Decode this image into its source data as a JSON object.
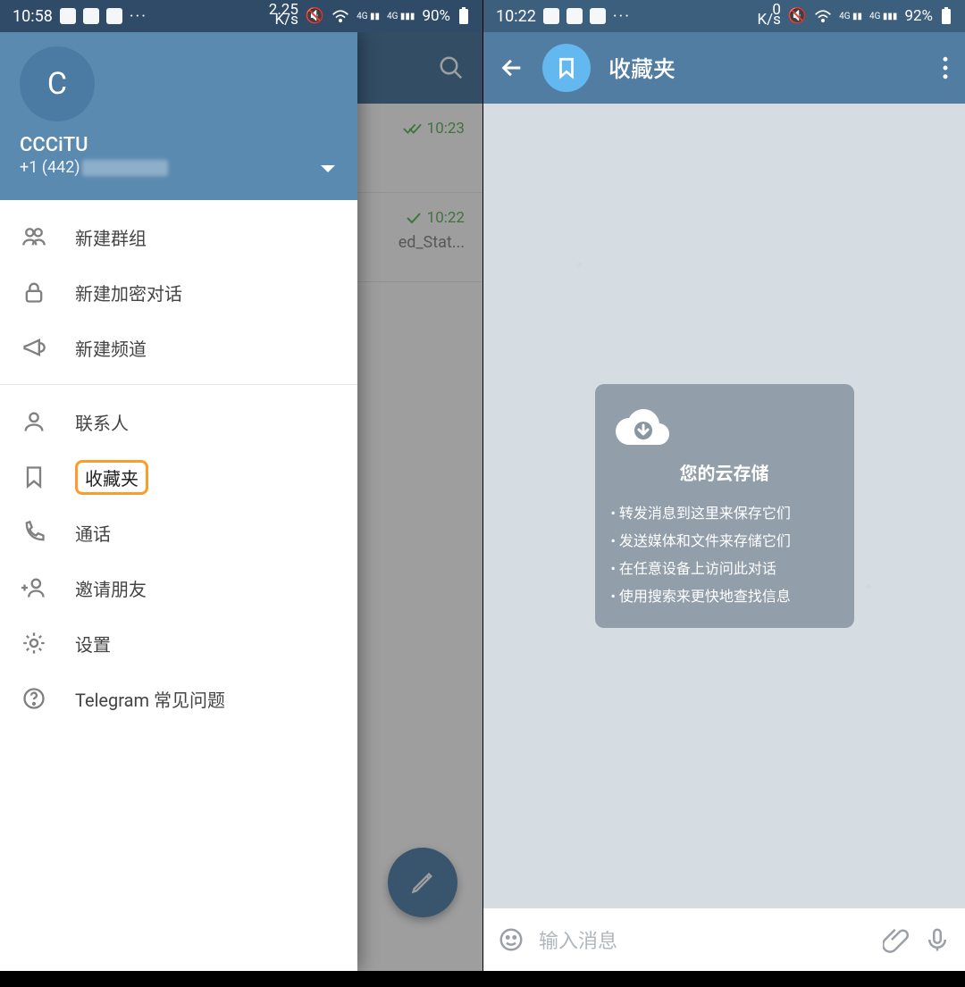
{
  "left": {
    "statusbar": {
      "time": "10:58",
      "rate": "2.25",
      "rate_unit": "K/s",
      "battery": "90%",
      "dots": "···"
    },
    "account": {
      "initial": "C",
      "name": "CCCiTU",
      "phone_prefix": "+1 (442)"
    },
    "chats": [
      {
        "time": "10:23"
      },
      {
        "time": "10:22",
        "snippet": "ed_Stat..."
      }
    ],
    "drawer": {
      "sections": [
        [
          {
            "id": "new-group",
            "label": "新建群组"
          },
          {
            "id": "new-secret",
            "label": "新建加密对话"
          },
          {
            "id": "new-channel",
            "label": "新建频道"
          }
        ],
        [
          {
            "id": "contacts",
            "label": "联系人"
          },
          {
            "id": "saved",
            "label": "收藏夹",
            "highlight": true
          },
          {
            "id": "calls",
            "label": "通话"
          },
          {
            "id": "invite",
            "label": "邀请朋友"
          },
          {
            "id": "settings",
            "label": "设置"
          },
          {
            "id": "faq",
            "label": "Telegram 常见问题"
          }
        ]
      ]
    }
  },
  "right": {
    "statusbar": {
      "time": "10:22",
      "rate": "0",
      "rate_unit": "K/s",
      "battery": "92%",
      "dots": "···"
    },
    "header": {
      "title": "收藏夹"
    },
    "cloud": {
      "title": "您的云存储",
      "bullets": [
        "转发消息到这里来保存它们",
        "发送媒体和文件来存储它们",
        "在任意设备上访问此对话",
        "使用搜索来更快地查找信息"
      ]
    },
    "input": {
      "placeholder": "输入消息"
    }
  }
}
